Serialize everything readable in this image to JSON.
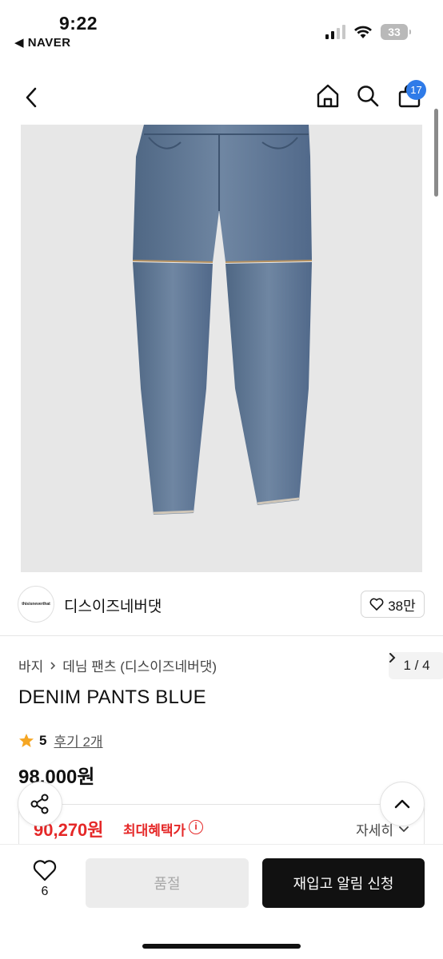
{
  "status_bar": {
    "time": "9:22",
    "back_app": "◀ NAVER",
    "battery": "33",
    "icons": [
      "signal-icon",
      "wifi-icon",
      "battery-icon"
    ]
  },
  "header": {
    "icons": [
      "back-chevron-icon",
      "home-icon",
      "search-icon",
      "cart-bag-icon"
    ],
    "cart_badge": "17"
  },
  "gallery": {
    "image": "denim-pants-photo",
    "counter": "1 / 4"
  },
  "brand": {
    "logo_text": "thisisneverthat",
    "name": "디스이즈네버댓",
    "like_count": "38만"
  },
  "product": {
    "breadcrumb": [
      "바지",
      "데님 팬츠 (디스이즈네버댓)"
    ],
    "title": "DENIM PANTS BLUE",
    "rating": "5",
    "review_link": "후기 2개",
    "price": "98,000원"
  },
  "benefit": {
    "max_price": "90,270원",
    "label": "최대혜택가",
    "detail_link": "자세히"
  },
  "bottom_bar": {
    "wish_count": "6",
    "soldout_label": "품절",
    "restock_label": "재입고 알림 신청"
  },
  "colors": {
    "accent_red": "#e52828",
    "badge_blue": "#2f7be8",
    "star": "#f5a623"
  }
}
